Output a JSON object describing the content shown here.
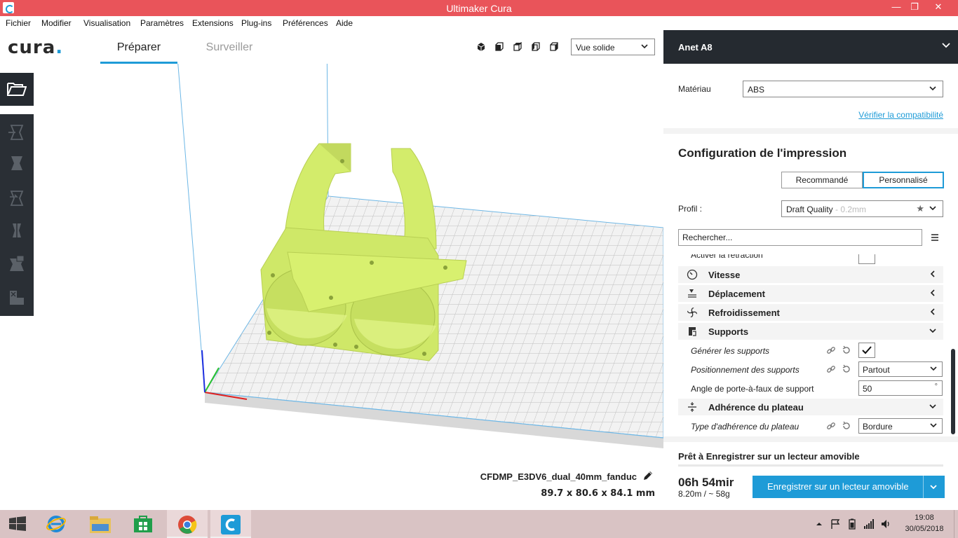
{
  "window": {
    "title": "Ultimaker Cura"
  },
  "menu": [
    "Fichier",
    "Modifier",
    "Visualisation",
    "Paramètres",
    "Extensions",
    "Plug-ins",
    "Préférences",
    "Aide"
  ],
  "header": {
    "logo": "cura",
    "tabs": [
      {
        "label": "Préparer",
        "active": true
      },
      {
        "label": "Surveiller",
        "active": false
      }
    ],
    "view_mode": "Vue solide"
  },
  "model": {
    "name": "CFDMP_E3DV6_dual_40mm_fanduc",
    "dimensions": "89.7 x 80.6 x 84.1 mm"
  },
  "panel": {
    "printer": "Anet A8",
    "material_label": "Matériau",
    "material": "ABS",
    "compat_link": "Vérifier la compatibilité",
    "config_title": "Configuration de l'impression",
    "modes": [
      "Recommandé",
      "Personnalisé"
    ],
    "profile_label": "Profil :",
    "profile": "Draft Quality",
    "profile_sub": " - 0.2mm",
    "search_value": "Rechercher...",
    "partial_setting": "Activer la rétraction",
    "categories": {
      "speed": "Vitesse",
      "travel": "Déplacement",
      "cooling": "Refroidissement",
      "support": "Supports",
      "adhesion": "Adhérence du plateau"
    },
    "settings": {
      "gen_support": "Générer les supports",
      "support_pos": "Positionnement des supports",
      "support_pos_value": "Partout",
      "overhang_angle": "Angle de porte-à-faux de support",
      "overhang_value": "50",
      "overhang_unit": "°",
      "adhesion_type": "Type d'adhérence du plateau",
      "adhesion_value": "Bordure"
    },
    "save_title": "Prêt à Enregistrer sur un lecteur amovible",
    "print_time": "06h 54mir",
    "print_material": "8.20m / ~ 58g",
    "save_button": "Enregistrer sur un lecteur amovible"
  },
  "taskbar": {
    "time": "19:08",
    "date": "30/05/2018"
  },
  "colors": {
    "accent": "#1e9bd7",
    "titlebar": "#e9545a",
    "dark": "#252a30",
    "model": "#d6ee6e"
  }
}
